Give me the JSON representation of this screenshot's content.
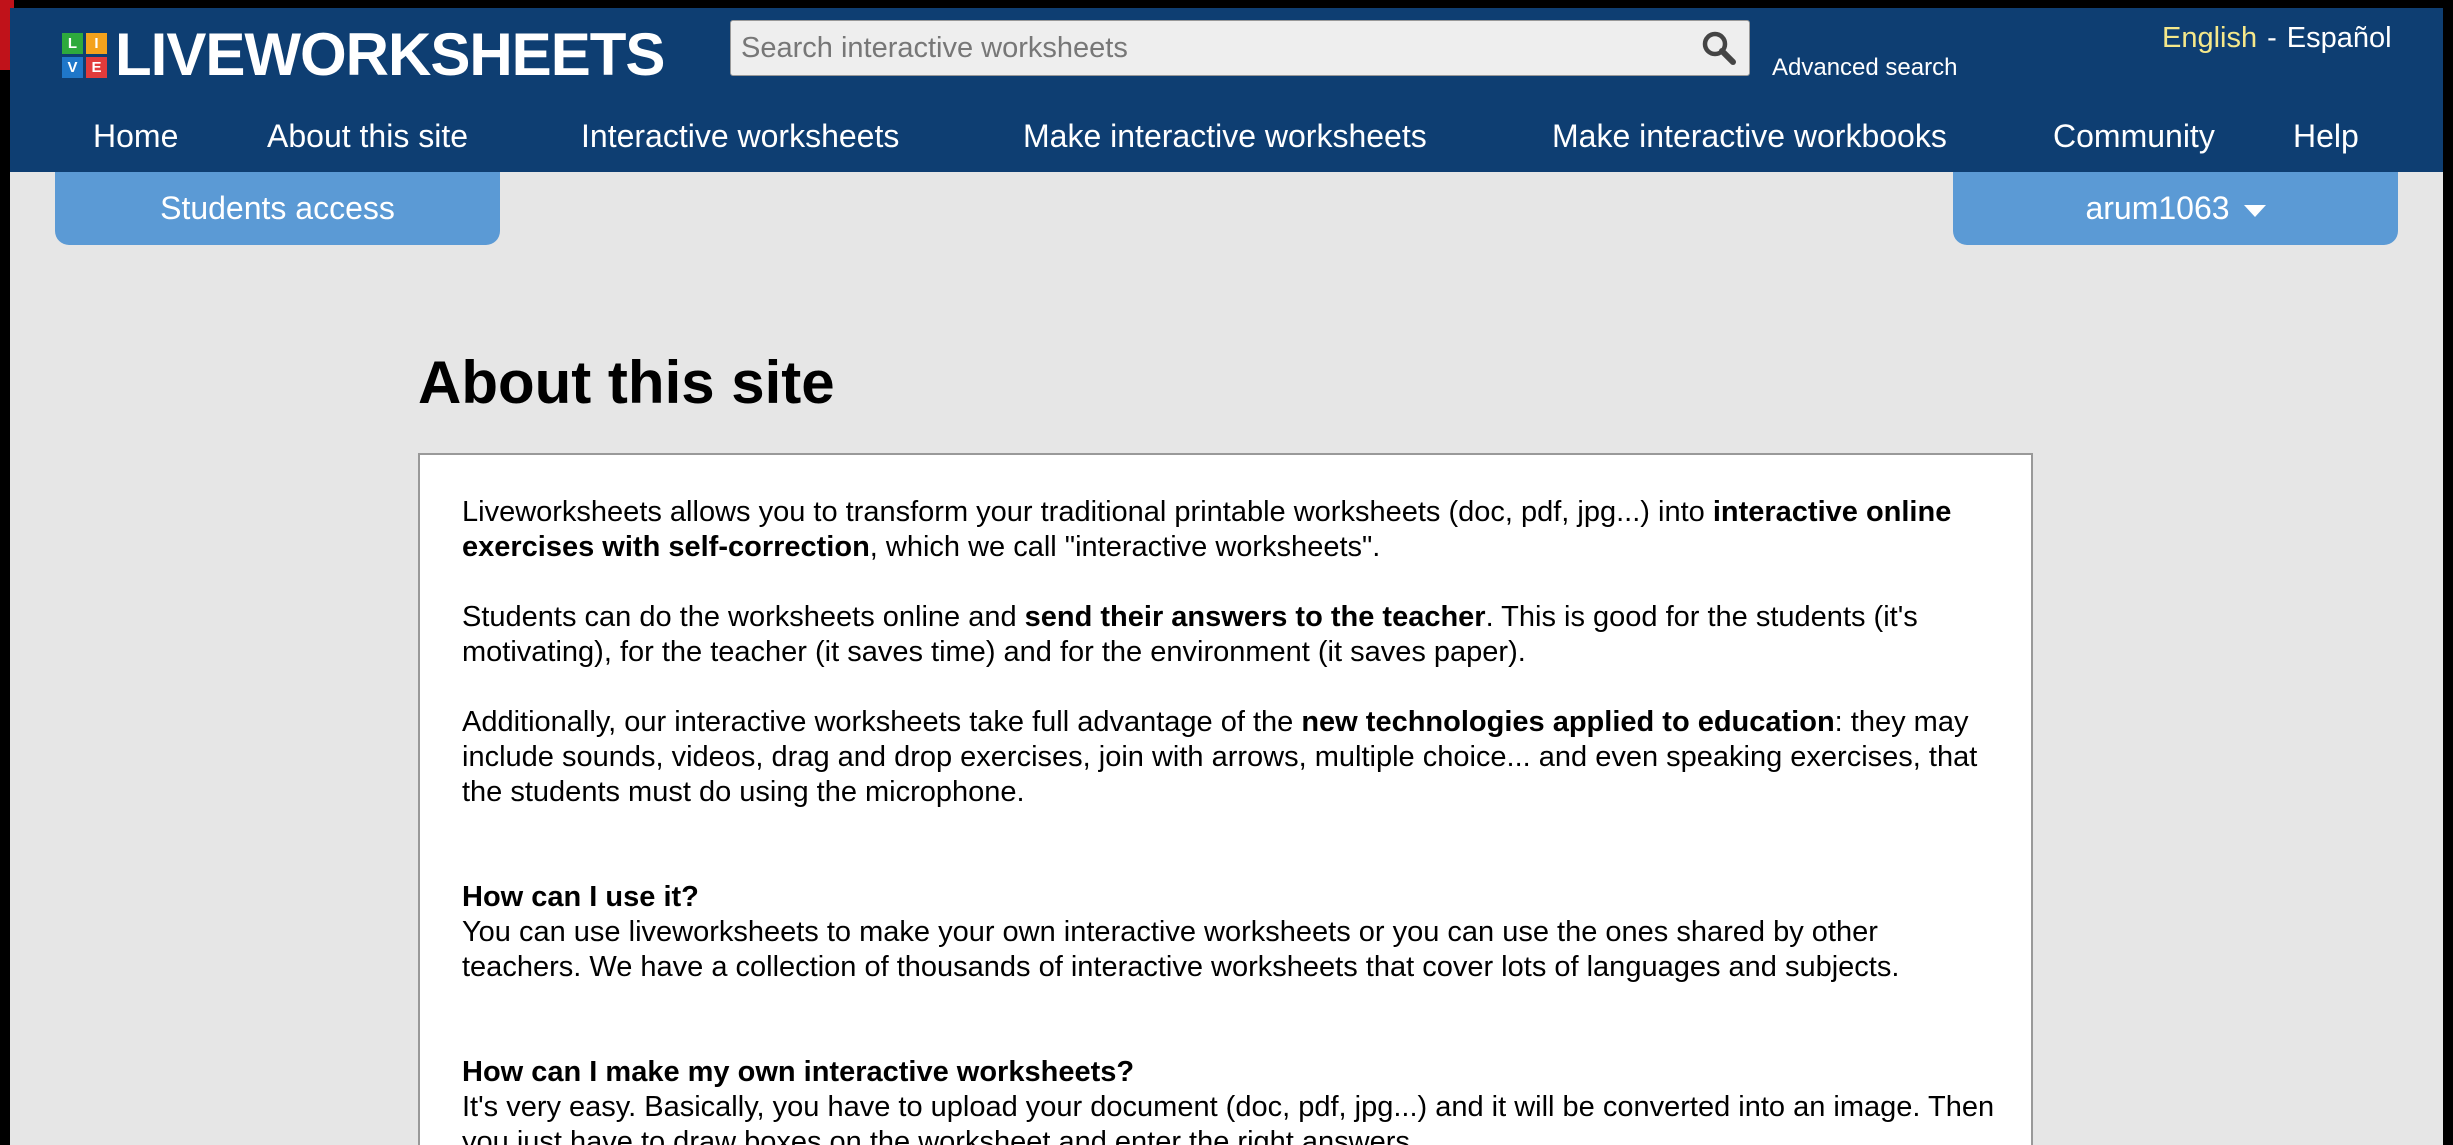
{
  "logo": {
    "letters": [
      "L",
      "I",
      "V",
      "E"
    ],
    "letter_colors": [
      "#2eaa3d",
      "#f4a21c",
      "#1f77c9",
      "#e23b3b"
    ],
    "text": "LIVEWORKSHEETS"
  },
  "search": {
    "placeholder": "Search interactive worksheets",
    "value": "",
    "icon": "search-icon"
  },
  "advanced_search": "Advanced search",
  "language": {
    "english": "English",
    "separator": "-",
    "spanish": "Español"
  },
  "nav": [
    "Home",
    "About this site",
    "Interactive worksheets",
    "Make interactive worksheets",
    "Make interactive workbooks",
    "Community",
    "Help"
  ],
  "students_access": "Students access",
  "user": {
    "name": "arum1063",
    "icon": "caret-down-icon"
  },
  "page_title": "About this site",
  "content": {
    "p1": {
      "t1": "Liveworksheets allows you to transform your traditional printable worksheets (doc, pdf, jpg...) into ",
      "b1": "interactive online exercises with self-correction",
      "t2": ", which we call \"interactive worksheets\"."
    },
    "p2": {
      "t1": "Students can do the worksheets online and ",
      "b1": "send their answers to the teacher",
      "t2": ". This is good for the students (it's motivating), for the teacher (it saves time) and for the environment (it saves paper)."
    },
    "p3": {
      "t1": "Additionally, our interactive worksheets take full advantage of the ",
      "b1": "new technologies applied to education",
      "t2": ": they may include sounds, videos, drag and drop exercises, join with arrows, multiple choice... and even speaking exercises, that the students must do using the microphone."
    },
    "h1": "How can I use it?",
    "p4": "You can use liveworksheets to make your own interactive worksheets or you can use the ones shared by other teachers. We have a collection of thousands of interactive worksheets that cover lots of languages and subjects.",
    "h2": "How can I make my own interactive worksheets?",
    "p5": "It's very easy. Basically, you have to upload your document (doc, pdf, jpg...) and it will be converted into an image. Then you just have to draw boxes on the worksheet and enter the right answers."
  },
  "colors": {
    "header": "#0e3e72",
    "tab": "#5b9ad5",
    "lang_active": "#f5e88a",
    "page_bg": "#e6e6e6"
  }
}
